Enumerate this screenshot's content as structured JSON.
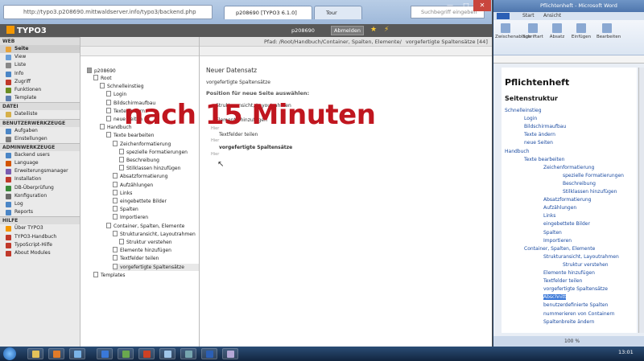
{
  "browser": {
    "url": "http://typo3.p208690.mittwaldserver.info/typo3/backend.php",
    "tabs": [
      {
        "label": "p208690 [TYPO3 6.1.0]",
        "active": true
      },
      {
        "label": "Tour",
        "active": false
      }
    ],
    "search_placeholder": "Suchbegriff eingeben",
    "controls": {
      "minimize": "—",
      "maximize": "□",
      "close": "✕"
    }
  },
  "typo3": {
    "logo": "TYPO3",
    "user": "p208690",
    "logout_label": "Abmelden",
    "star": "★",
    "bolt": "⚡"
  },
  "modules": {
    "groups": [
      {
        "title": "WEB",
        "items": [
          {
            "label": "Seite",
            "color": "#e8a33a",
            "selected": true
          },
          {
            "label": "View",
            "color": "#6a9fd8"
          },
          {
            "label": "Liste",
            "color": "#888888"
          },
          {
            "label": "Info",
            "color": "#4b86c6"
          },
          {
            "label": "Zugriff",
            "color": "#c0392b"
          },
          {
            "label": "Funktionen",
            "color": "#6b8e23"
          },
          {
            "label": "Template",
            "color": "#5d7fb0"
          }
        ]
      },
      {
        "title": "DATEI",
        "items": [
          {
            "label": "Dateiliste",
            "color": "#d6b04a"
          }
        ]
      },
      {
        "title": "BENUTZERWERKZEUGE",
        "items": [
          {
            "label": "Aufgaben",
            "color": "#4b86c6"
          },
          {
            "label": "Einstellungen",
            "color": "#7b7b7b"
          }
        ]
      },
      {
        "title": "ADMINWERKZEUGE",
        "items": [
          {
            "label": "Backend users",
            "color": "#4b86c6"
          },
          {
            "label": "Language",
            "color": "#d35400"
          },
          {
            "label": "Erweiterungsmanager",
            "color": "#7a5cb0"
          },
          {
            "label": "Installation",
            "color": "#c0392b"
          },
          {
            "label": "DB-Überprüfung",
            "color": "#3a8a3a"
          },
          {
            "label": "Konfiguration",
            "color": "#6b6b6b"
          },
          {
            "label": "Log",
            "color": "#4b86c6"
          },
          {
            "label": "Reports",
            "color": "#4b86c6"
          }
        ]
      },
      {
        "title": "HILFE",
        "items": [
          {
            "label": "Über TYPO3",
            "color": "#f49700"
          },
          {
            "label": "TYPO3-Handbuch",
            "color": "#c0392b"
          },
          {
            "label": "TypoScript-Hilfe",
            "color": "#c0392b"
          },
          {
            "label": "About Modules",
            "color": "#c0392b"
          }
        ]
      }
    ]
  },
  "tree": {
    "root": "p208690",
    "nodes": [
      {
        "label": "Root",
        "level": 1
      },
      {
        "label": "Schnelleinstieg",
        "level": 2
      },
      {
        "label": "Login",
        "level": 3
      },
      {
        "label": "Bildschirmaufbau",
        "level": 3
      },
      {
        "label": "Texte ändern",
        "level": 3
      },
      {
        "label": "neue Seiten",
        "level": 3
      },
      {
        "label": "Handbuch",
        "level": 2
      },
      {
        "label": "Texte bearbeiten",
        "level": 3
      },
      {
        "label": "Zeichenformatierung",
        "level": 4
      },
      {
        "label": "spezielle Formatierungen",
        "level": 5
      },
      {
        "label": "Beschreibung",
        "level": 5
      },
      {
        "label": "Stilklassen hinzufügen",
        "level": 5
      },
      {
        "label": "Absatzformatierung",
        "level": 4
      },
      {
        "label": "Aufzählungen",
        "level": 4
      },
      {
        "label": "Links",
        "level": 4
      },
      {
        "label": "eingebettete Bilder",
        "level": 4
      },
      {
        "label": "Spalten",
        "level": 4
      },
      {
        "label": "Importieren",
        "level": 4
      },
      {
        "label": "Container, Spalten, Elemente",
        "level": 3
      },
      {
        "label": "Strukturansicht, Layoutrahmen",
        "level": 4
      },
      {
        "label": "Struktur verstehen",
        "level": 5
      },
      {
        "label": "Elemente hinzufügen",
        "level": 4
      },
      {
        "label": "Textfelder teilen",
        "level": 4
      },
      {
        "label": "vorgefertigte Spaltensätze",
        "level": 4,
        "highlight": true
      },
      {
        "label": "Templates",
        "level": 1
      }
    ]
  },
  "content": {
    "path": "Pfad: /Root/Handbuch/Container, Spalten, Elemente/",
    "record": "vorgefertigte Spaltensätze [44]",
    "heading": "Neuer Datensatz",
    "record_line": "vorgefertigte Spaltensätze",
    "position_heading": "Position für neue Seite auswählen:",
    "positions": [
      "Strukturansicht, Layoutrahmen",
      "Elemente hinzufügen",
      "Textfelder teilen",
      "vorgefertigte Spaltensätze"
    ],
    "insert_marker": "Hier"
  },
  "overlay": {
    "text": "nach 15 Minuten"
  },
  "word": {
    "title": "Pflichtenheft - Microsoft Word",
    "tabs": [
      "Start",
      "Ansicht"
    ],
    "ribbon": [
      "Zwischenablage",
      "Schriftart",
      "Absatz",
      "Einfügen",
      "Bearbeiten"
    ],
    "doc_title": "Pflichtenheft",
    "section": "Seitenstruktur",
    "lines": [
      {
        "text": "Schnelleinstieg",
        "indent": 0
      },
      {
        "text": "Login",
        "indent": 1
      },
      {
        "text": "Bildschirmaufbau",
        "indent": 1
      },
      {
        "text": "Texte ändern",
        "indent": 1
      },
      {
        "text": "neue Seiten",
        "indent": 1
      },
      {
        "text": "Handbuch",
        "indent": 0
      },
      {
        "text": "Texte bearbeiten",
        "indent": 1
      },
      {
        "text": "Zeichenformatierung",
        "indent": 2
      },
      {
        "text": "spezielle Formatierungen",
        "indent": 3
      },
      {
        "text": "Beschreibung",
        "indent": 3
      },
      {
        "text": "Stilklassen hinzufügen",
        "indent": 3
      },
      {
        "text": "Absatzformatierung",
        "indent": 2
      },
      {
        "text": "Aufzählungen",
        "indent": 2
      },
      {
        "text": "Links",
        "indent": 2
      },
      {
        "text": "eingebettete Bilder",
        "indent": 2
      },
      {
        "text": "Spalten",
        "indent": 2
      },
      {
        "text": "Importieren",
        "indent": 2
      },
      {
        "text": "Container, Spalten, Elemente",
        "indent": 1
      },
      {
        "text": "Strukturansicht, Layoutrahmen",
        "indent": 2
      },
      {
        "text": "Struktur verstehen",
        "indent": 3
      },
      {
        "text": "Elemente hinzufügen",
        "indent": 2
      },
      {
        "text": "Textfelder teilen",
        "indent": 2
      },
      {
        "text": "vorgefertigte Spaltensätze",
        "indent": 2
      },
      {
        "text": "Abschnitt",
        "indent": 2,
        "selected": true
      },
      {
        "text": "benutzerdefinierte Spalten",
        "indent": 2
      },
      {
        "text": "nummerieren von Containern",
        "indent": 2
      },
      {
        "text": "Spaltenbreite ändern",
        "indent": 2
      }
    ],
    "zoom": "100 %"
  },
  "taskbar": {
    "clock": "13:01"
  }
}
